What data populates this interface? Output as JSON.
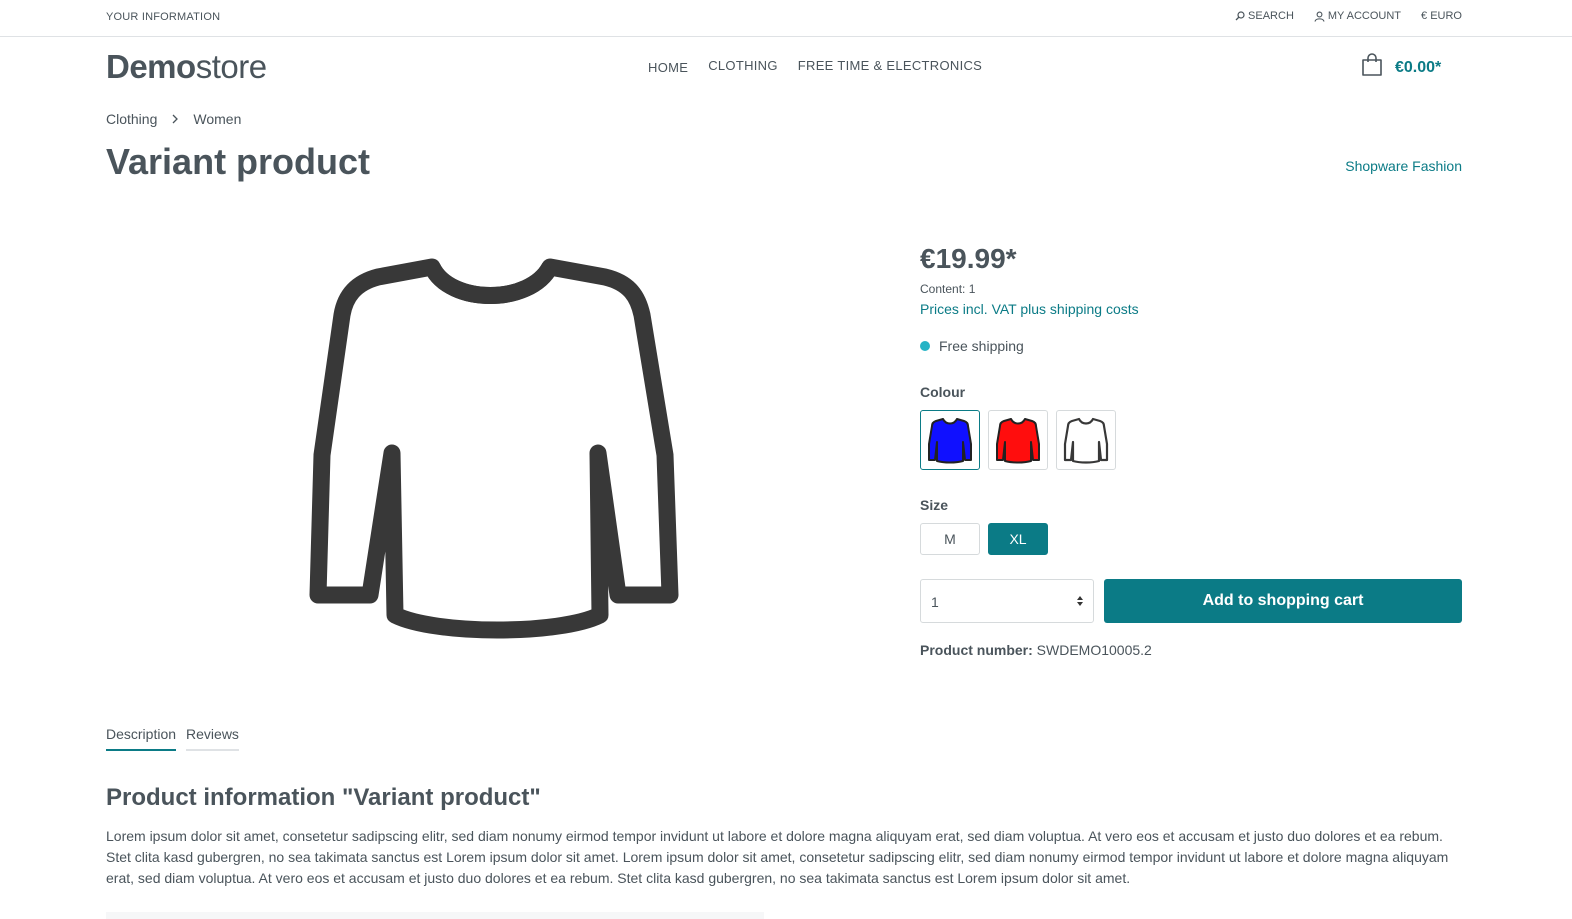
{
  "topbar": {
    "info_label": "YOUR INFORMATION",
    "search_label": "SEARCH",
    "account_label": "MY ACCOUNT",
    "currency_label": "€ EURO"
  },
  "header": {
    "logo_bold": "Demo",
    "logo_light": "store",
    "nav": [
      "HOME",
      "CLOTHING",
      "FREE TIME & ELECTRONICS"
    ],
    "cart_total": "€0.00*"
  },
  "breadcrumb": [
    "Clothing",
    "Women"
  ],
  "product": {
    "title": "Variant product",
    "manufacturer": "Shopware Fashion",
    "price": "€19.99*",
    "content": "Content: 1",
    "vat_link": "Prices incl. VAT plus shipping costs",
    "shipping": "Free shipping",
    "colour_label": "Colour",
    "colours": [
      {
        "name": "blue",
        "color": "#1010ff",
        "selected": true
      },
      {
        "name": "red",
        "color": "#ff0d0d",
        "selected": false
      },
      {
        "name": "white",
        "color": "#ffffff",
        "selected": false
      }
    ],
    "size_label": "Size",
    "sizes": [
      {
        "label": "M",
        "selected": false
      },
      {
        "label": "XL",
        "selected": true
      }
    ],
    "quantity": "1",
    "add_to_cart": "Add to shopping cart",
    "number_label": "Product number:",
    "number_value": "SWDEMO10005.2"
  },
  "tabs": [
    "Description",
    "Reviews"
  ],
  "description": {
    "title": "Product information \"Variant product\"",
    "text": "Lorem ipsum dolor sit amet, consetetur sadipscing elitr, sed diam nonumy eirmod tempor invidunt ut labore et dolore magna aliquyam erat, sed diam voluptua. At vero eos et accusam et justo duo dolores et ea rebum. Stet clita kasd gubergren, no sea takimata sanctus est Lorem ipsum dolor sit amet. Lorem ipsum dolor sit amet, consetetur sadipscing elitr, sed diam nonumy eirmod tempor invidunt ut labore et dolore magna aliquyam erat, sed diam voluptua. At vero eos et accusam et justo duo dolores et ea rebum. Stet clita kasd gubergren, no sea takimata sanctus est Lorem ipsum dolor sit amet."
  },
  "colors": {
    "accent": "#0b7b86",
    "text": "#4a545b",
    "shipping_dot": "#26b3c5"
  }
}
